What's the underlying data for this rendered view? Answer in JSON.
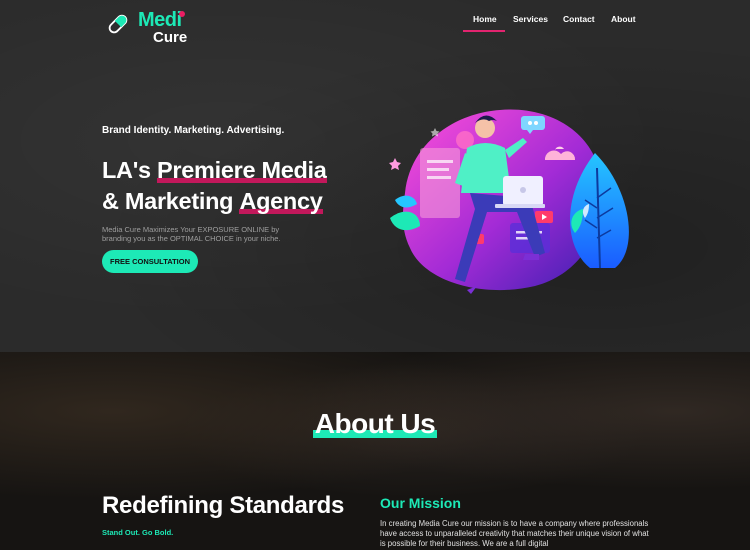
{
  "brand": {
    "name_top": "Medi",
    "name_bottom": "Cure",
    "accent": "#1de9b6",
    "highlight": "#c2185b"
  },
  "nav": {
    "items": [
      {
        "label": "Home",
        "active": true
      },
      {
        "label": "Services"
      },
      {
        "label": "Contact"
      },
      {
        "label": "About"
      }
    ]
  },
  "hero": {
    "tagline": "Brand Identity. Marketing. Advertising.",
    "headline_line1_plain": "LA's ",
    "headline_line1_highlight": "Premiere Media",
    "headline_line2_plain": "& Marketing ",
    "headline_line2_highlight": "Agency",
    "description": "Media Cure Maximizes Your EXPOSURE ONLINE by branding you as the OPTIMAL CHOICE in your niche.",
    "cta_label": "FREE CONSULTATION"
  },
  "about": {
    "title": "About Us",
    "left_title": "Redefining Standards",
    "left_subtitle": "Stand Out. Go Bold.",
    "mission_title": "Our Mission",
    "mission_text": "In creating Media Cure our mission is to have a company where professionals have access to unparalleled creativity that matches their unique vision of what is possible for their business. We are a full digital"
  }
}
